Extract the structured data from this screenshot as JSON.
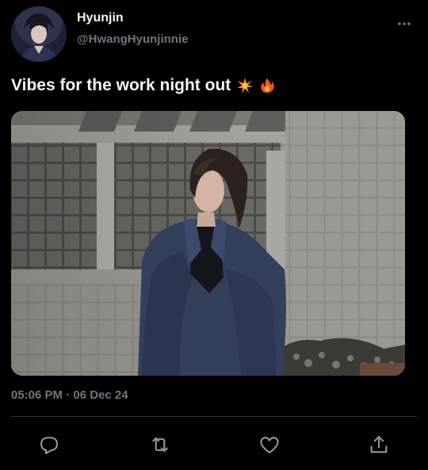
{
  "author": {
    "display_name": "Hyunjin",
    "handle": "@HwangHyunjinnie"
  },
  "tweet": {
    "text": "Vibes for the work night out",
    "emojis": [
      "sparkle-explosion-icon",
      "fire-icon"
    ],
    "timestamp": "05:06 PM · 06 Dec 24"
  },
  "actions": [
    {
      "name": "reply-icon"
    },
    {
      "name": "retweet-icon"
    },
    {
      "name": "like-icon"
    },
    {
      "name": "share-icon"
    }
  ],
  "colors": {
    "background": "#000000",
    "primary_text": "#f5f5f5",
    "secondary_text": "#6e767d",
    "icon": "#8b98a5",
    "divider": "#2f3336"
  }
}
